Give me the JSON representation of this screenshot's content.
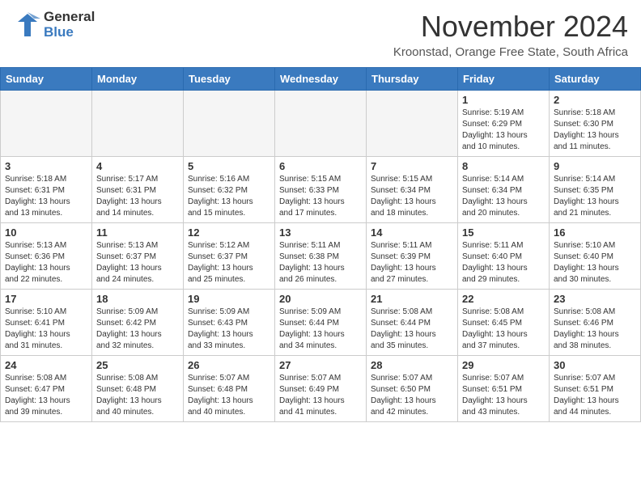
{
  "header": {
    "logo_general": "General",
    "logo_blue": "Blue",
    "month_title": "November 2024",
    "subtitle": "Kroonstad, Orange Free State, South Africa"
  },
  "days_of_week": [
    "Sunday",
    "Monday",
    "Tuesday",
    "Wednesday",
    "Thursday",
    "Friday",
    "Saturday"
  ],
  "weeks": [
    [
      {
        "day": "",
        "info": ""
      },
      {
        "day": "",
        "info": ""
      },
      {
        "day": "",
        "info": ""
      },
      {
        "day": "",
        "info": ""
      },
      {
        "day": "",
        "info": ""
      },
      {
        "day": "1",
        "info": "Sunrise: 5:19 AM\nSunset: 6:29 PM\nDaylight: 13 hours\nand 10 minutes."
      },
      {
        "day": "2",
        "info": "Sunrise: 5:18 AM\nSunset: 6:30 PM\nDaylight: 13 hours\nand 11 minutes."
      }
    ],
    [
      {
        "day": "3",
        "info": "Sunrise: 5:18 AM\nSunset: 6:31 PM\nDaylight: 13 hours\nand 13 minutes."
      },
      {
        "day": "4",
        "info": "Sunrise: 5:17 AM\nSunset: 6:31 PM\nDaylight: 13 hours\nand 14 minutes."
      },
      {
        "day": "5",
        "info": "Sunrise: 5:16 AM\nSunset: 6:32 PM\nDaylight: 13 hours\nand 15 minutes."
      },
      {
        "day": "6",
        "info": "Sunrise: 5:15 AM\nSunset: 6:33 PM\nDaylight: 13 hours\nand 17 minutes."
      },
      {
        "day": "7",
        "info": "Sunrise: 5:15 AM\nSunset: 6:34 PM\nDaylight: 13 hours\nand 18 minutes."
      },
      {
        "day": "8",
        "info": "Sunrise: 5:14 AM\nSunset: 6:34 PM\nDaylight: 13 hours\nand 20 minutes."
      },
      {
        "day": "9",
        "info": "Sunrise: 5:14 AM\nSunset: 6:35 PM\nDaylight: 13 hours\nand 21 minutes."
      }
    ],
    [
      {
        "day": "10",
        "info": "Sunrise: 5:13 AM\nSunset: 6:36 PM\nDaylight: 13 hours\nand 22 minutes."
      },
      {
        "day": "11",
        "info": "Sunrise: 5:13 AM\nSunset: 6:37 PM\nDaylight: 13 hours\nand 24 minutes."
      },
      {
        "day": "12",
        "info": "Sunrise: 5:12 AM\nSunset: 6:37 PM\nDaylight: 13 hours\nand 25 minutes."
      },
      {
        "day": "13",
        "info": "Sunrise: 5:11 AM\nSunset: 6:38 PM\nDaylight: 13 hours\nand 26 minutes."
      },
      {
        "day": "14",
        "info": "Sunrise: 5:11 AM\nSunset: 6:39 PM\nDaylight: 13 hours\nand 27 minutes."
      },
      {
        "day": "15",
        "info": "Sunrise: 5:11 AM\nSunset: 6:40 PM\nDaylight: 13 hours\nand 29 minutes."
      },
      {
        "day": "16",
        "info": "Sunrise: 5:10 AM\nSunset: 6:40 PM\nDaylight: 13 hours\nand 30 minutes."
      }
    ],
    [
      {
        "day": "17",
        "info": "Sunrise: 5:10 AM\nSunset: 6:41 PM\nDaylight: 13 hours\nand 31 minutes."
      },
      {
        "day": "18",
        "info": "Sunrise: 5:09 AM\nSunset: 6:42 PM\nDaylight: 13 hours\nand 32 minutes."
      },
      {
        "day": "19",
        "info": "Sunrise: 5:09 AM\nSunset: 6:43 PM\nDaylight: 13 hours\nand 33 minutes."
      },
      {
        "day": "20",
        "info": "Sunrise: 5:09 AM\nSunset: 6:44 PM\nDaylight: 13 hours\nand 34 minutes."
      },
      {
        "day": "21",
        "info": "Sunrise: 5:08 AM\nSunset: 6:44 PM\nDaylight: 13 hours\nand 35 minutes."
      },
      {
        "day": "22",
        "info": "Sunrise: 5:08 AM\nSunset: 6:45 PM\nDaylight: 13 hours\nand 37 minutes."
      },
      {
        "day": "23",
        "info": "Sunrise: 5:08 AM\nSunset: 6:46 PM\nDaylight: 13 hours\nand 38 minutes."
      }
    ],
    [
      {
        "day": "24",
        "info": "Sunrise: 5:08 AM\nSunset: 6:47 PM\nDaylight: 13 hours\nand 39 minutes."
      },
      {
        "day": "25",
        "info": "Sunrise: 5:08 AM\nSunset: 6:48 PM\nDaylight: 13 hours\nand 40 minutes."
      },
      {
        "day": "26",
        "info": "Sunrise: 5:07 AM\nSunset: 6:48 PM\nDaylight: 13 hours\nand 40 minutes."
      },
      {
        "day": "27",
        "info": "Sunrise: 5:07 AM\nSunset: 6:49 PM\nDaylight: 13 hours\nand 41 minutes."
      },
      {
        "day": "28",
        "info": "Sunrise: 5:07 AM\nSunset: 6:50 PM\nDaylight: 13 hours\nand 42 minutes."
      },
      {
        "day": "29",
        "info": "Sunrise: 5:07 AM\nSunset: 6:51 PM\nDaylight: 13 hours\nand 43 minutes."
      },
      {
        "day": "30",
        "info": "Sunrise: 5:07 AM\nSunset: 6:51 PM\nDaylight: 13 hours\nand 44 minutes."
      }
    ]
  ]
}
